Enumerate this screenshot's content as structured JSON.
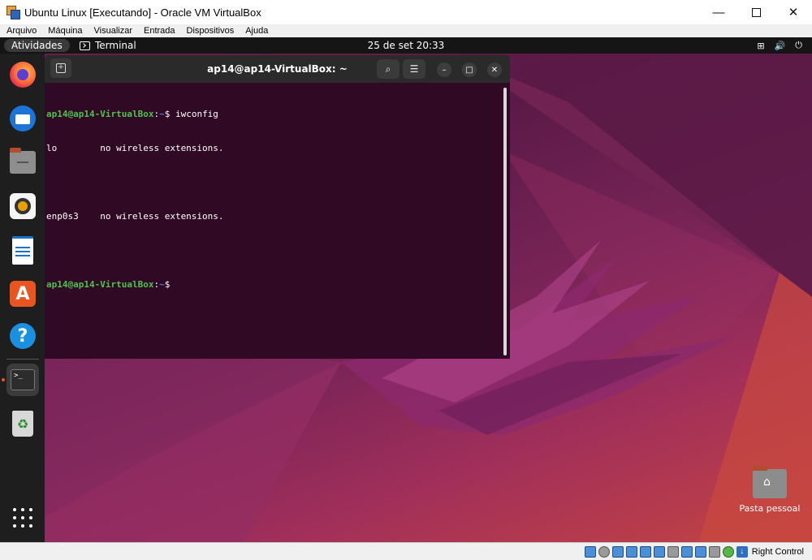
{
  "host_window": {
    "title": "Ubuntu Linux [Executando] - Oracle VM VirtualBox",
    "controls": {
      "minimize": "—",
      "close": "✕"
    },
    "menu": [
      "Arquivo",
      "Máquina",
      "Visualizar",
      "Entrada",
      "Dispositivos",
      "Ajuda"
    ],
    "status": {
      "host_key": "Right Control"
    }
  },
  "topbar": {
    "activities": "Atividades",
    "app_name": "Terminal",
    "clock": "25 de set  20:33",
    "tray": {
      "network": "⊞",
      "volume": "🔊",
      "power": "⏻"
    }
  },
  "dock": {
    "software_glyph": "A",
    "help_glyph": "?",
    "terminal_glyph": ">_",
    "trash_glyph": "♻"
  },
  "terminal": {
    "title": "ap14@ap14-VirtualBox: ~",
    "new_tab_glyph": "+",
    "search_glyph": "⌕",
    "menu_glyph": "☰",
    "minimize_glyph": "–",
    "maximize_glyph": "□",
    "close_glyph": "✕",
    "prompt": {
      "user_host": "ap14@ap14-VirtualBox",
      "separator": ":",
      "path": "~",
      "symbol": "$"
    },
    "commands": {
      "first": " iwconfig",
      "second": ""
    },
    "output": [
      "lo        no wireless extensions.",
      "",
      "enp0s3    no wireless extensions."
    ]
  },
  "desktop": {
    "home_folder_label": "Pasta pessoal",
    "home_glyph": "⌂"
  }
}
